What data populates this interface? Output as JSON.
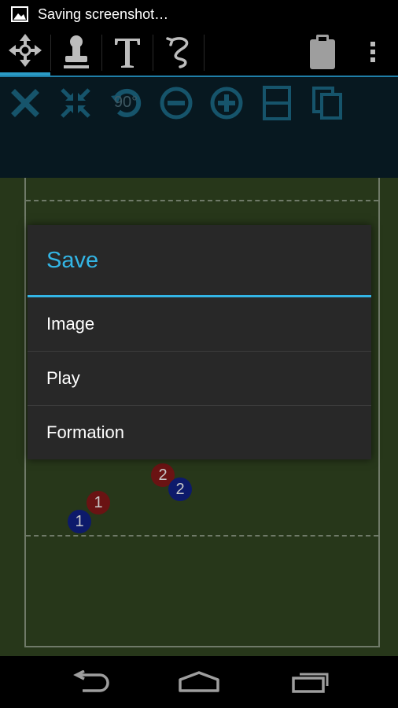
{
  "status_bar": {
    "notification_icon": "image-icon",
    "notification_text": "Saving screenshot…"
  },
  "action_bar": {
    "tabs": [
      {
        "name": "move-tool",
        "icon": "move-arrows-icon",
        "selected": true
      },
      {
        "name": "stamp-tool",
        "icon": "stamp-icon",
        "selected": false
      },
      {
        "name": "text-tool",
        "icon": "text-icon",
        "selected": false
      },
      {
        "name": "draw-tool",
        "icon": "squiggle-icon",
        "selected": false
      }
    ],
    "right_icons": [
      "clipboard-icon",
      "overflow-menu-icon"
    ]
  },
  "toolbar": {
    "icons": [
      "delete-x-icon",
      "collapse-icon",
      "rotate-icon",
      "zoom-out-icon",
      "zoom-in-icon",
      "split-layout-icon",
      "duplicate-icon"
    ],
    "rotate_label": "90°"
  },
  "field": {
    "players": [
      {
        "team": "red",
        "number": "2"
      },
      {
        "team": "blue",
        "number": "2"
      },
      {
        "team": "red",
        "number": "1"
      },
      {
        "team": "blue",
        "number": "1"
      }
    ]
  },
  "dialog": {
    "title": "Save",
    "items": [
      "Image",
      "Play",
      "Formation"
    ]
  },
  "nav_bar": {
    "buttons": [
      "back-icon",
      "home-icon",
      "recent-apps-icon"
    ]
  },
  "colors": {
    "accent": "#33b5e5",
    "dialog_bg": "#282828",
    "field_green": "#27371a",
    "red_player": "#6a1313",
    "blue_player": "#0d1a6b"
  }
}
